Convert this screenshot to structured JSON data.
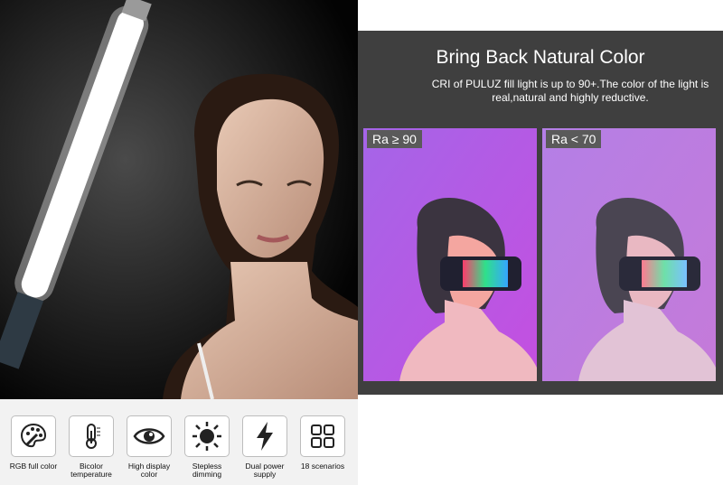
{
  "comparison": {
    "headline": "Bring Back Natural Color",
    "subtext": "CRI of PULUZ fill light is up to 90+.The color of the light is real,natural and highly reductive.",
    "cards": [
      {
        "badge": "Ra ≥ 90"
      },
      {
        "badge": "Ra < 70"
      }
    ]
  },
  "features": [
    {
      "label": "RGB full color",
      "icon": "palette-icon"
    },
    {
      "label": "Bicolor temperature",
      "icon": "thermometer-icon"
    },
    {
      "label": "High display color",
      "icon": "eye-icon"
    },
    {
      "label": "Stepless dimming",
      "icon": "sun-icon"
    },
    {
      "label": "Dual power supply",
      "icon": "lightning-icon"
    },
    {
      "label": "18 scenarios",
      "icon": "grid-icon"
    }
  ],
  "colors": {
    "panel": "#3f3f3f",
    "accent_purple": "#a070e0",
    "light_tube": "#ffffff"
  }
}
